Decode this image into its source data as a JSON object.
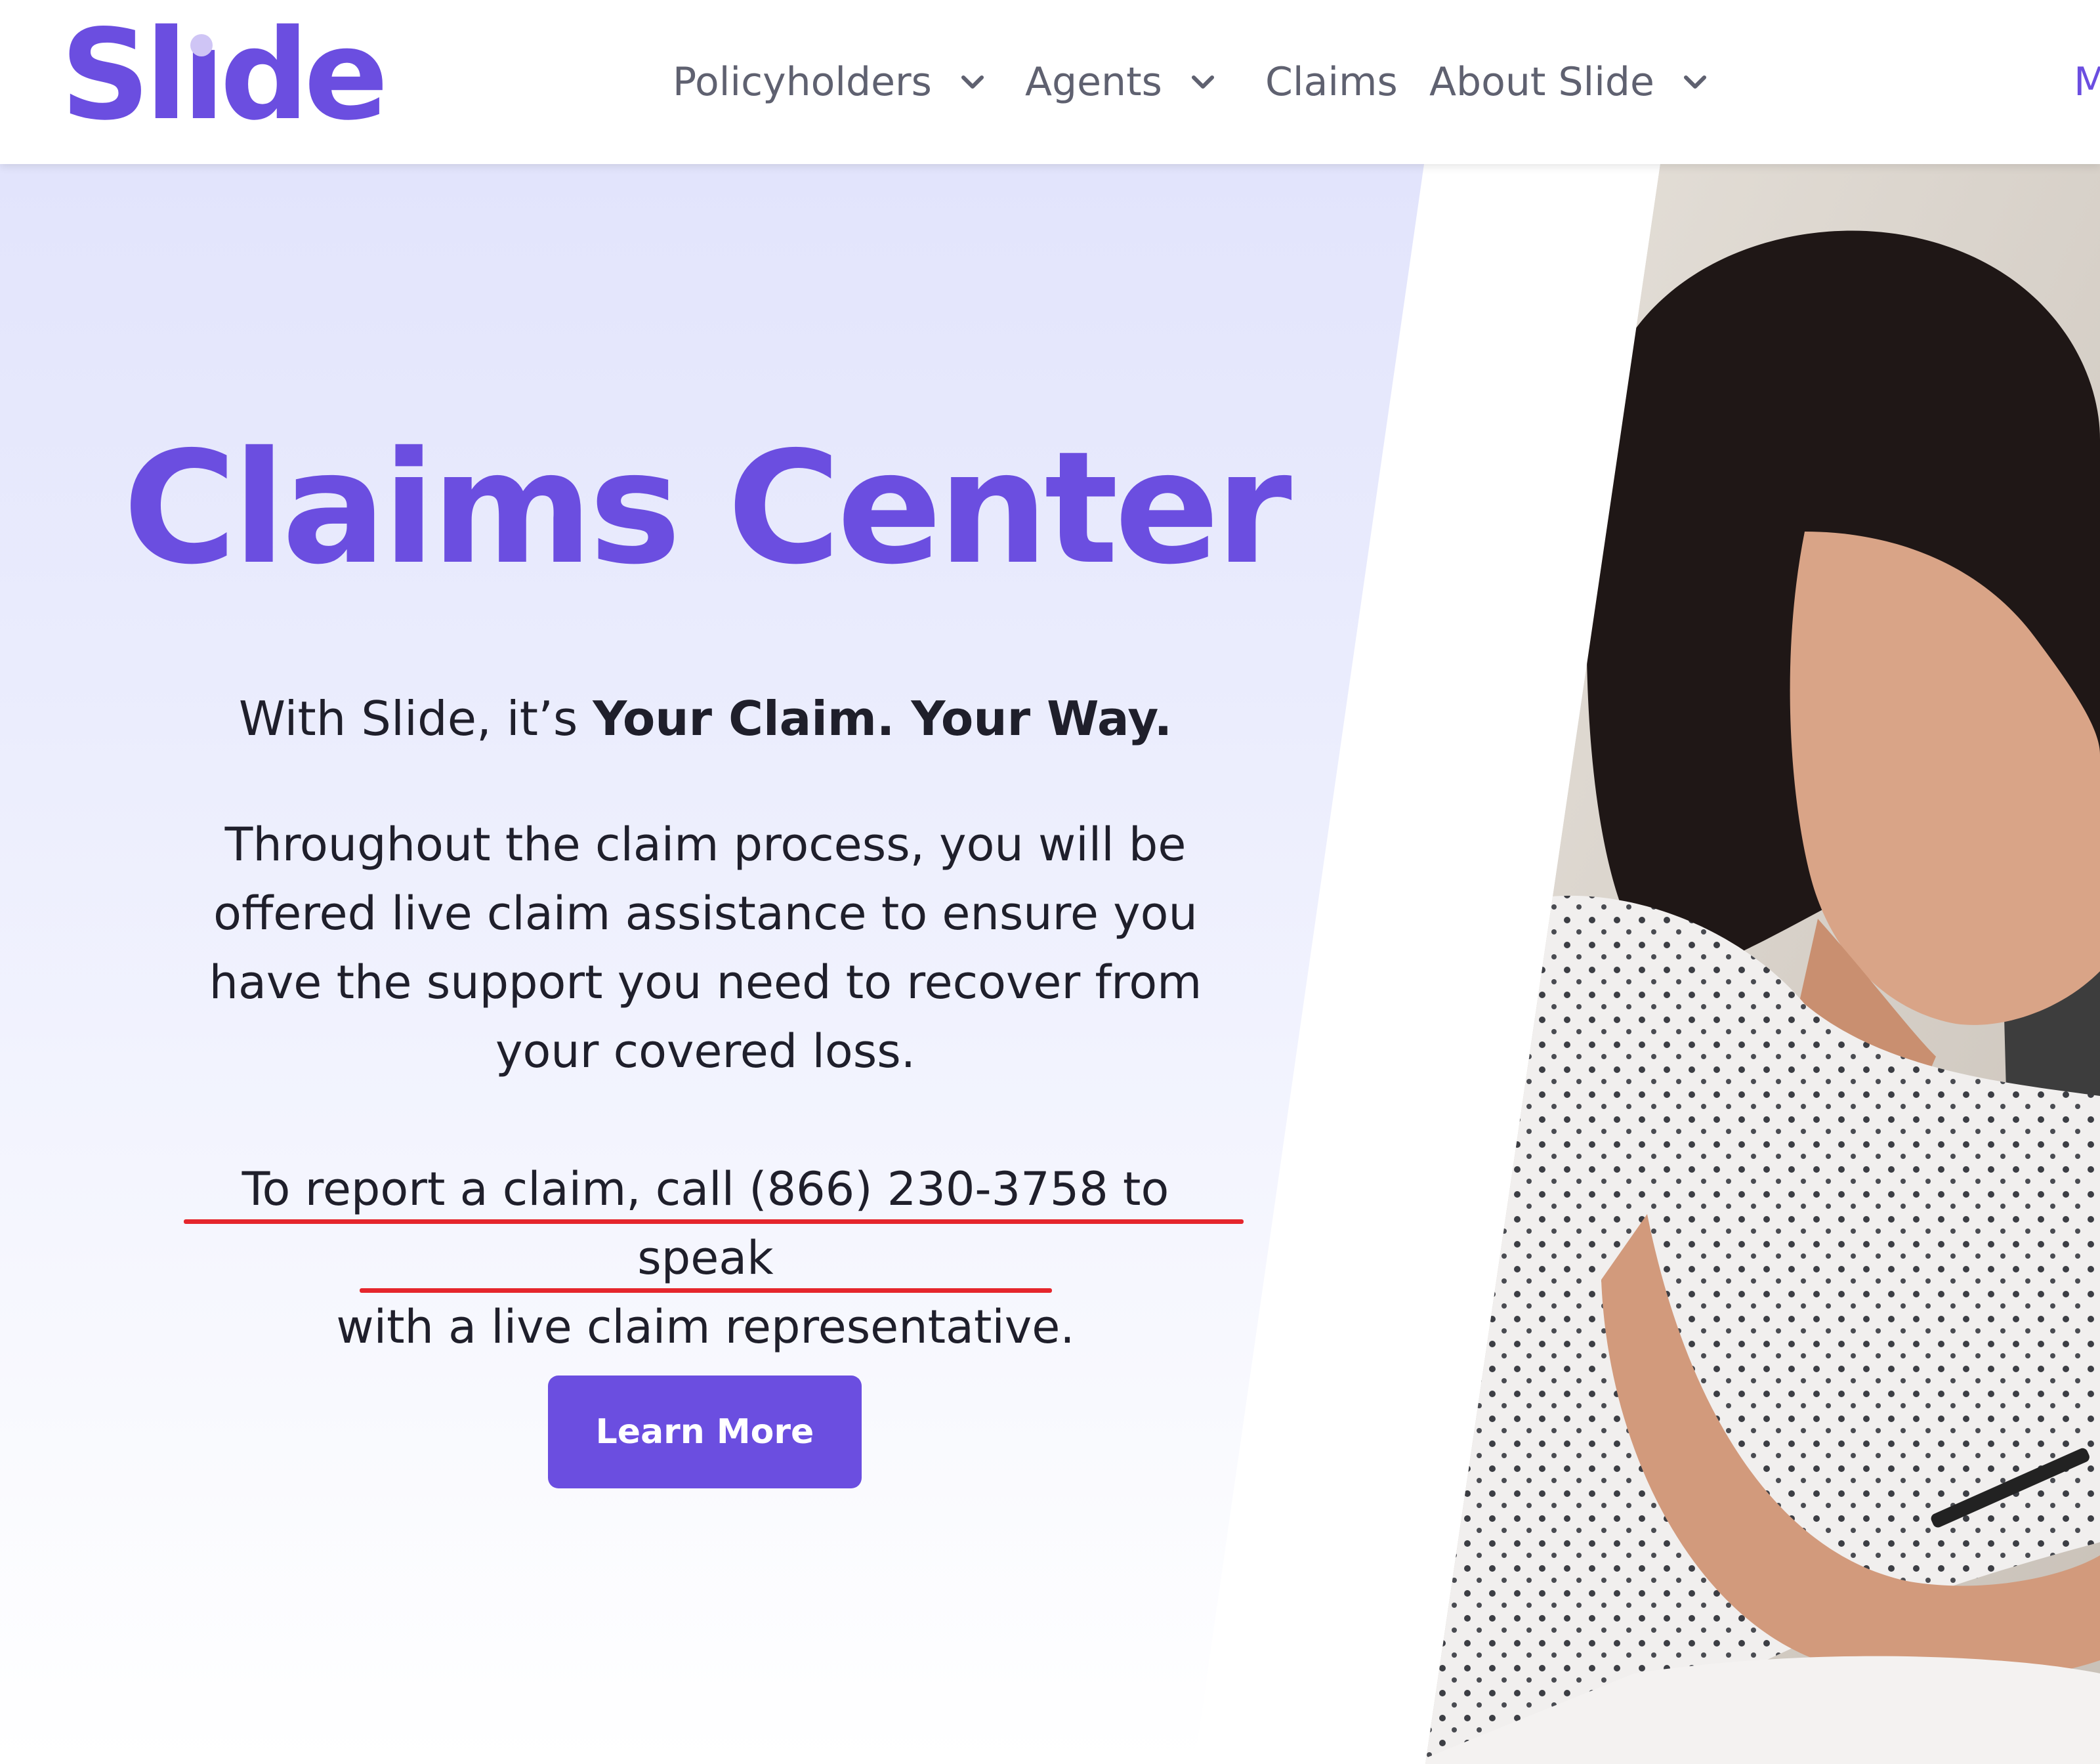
{
  "header": {
    "logo_text": "Slide",
    "nav": [
      {
        "label": "Policyholders",
        "has_dropdown": true
      },
      {
        "label": "Agents",
        "has_dropdown": true
      },
      {
        "label": "Claims",
        "has_dropdown": false
      },
      {
        "label": "About Slide",
        "has_dropdown": true
      }
    ],
    "cut_off_item": "M"
  },
  "hero": {
    "title": "Claims Center",
    "tagline_prefix": "With Slide, it’s ",
    "tagline_emphasis": "Your Claim. Your Way.",
    "paragraph": "Throughout the claim process, you will be offered live claim assistance to ensure you have the support you need to recover from your covered loss.",
    "report_line_1": "To report a claim, call (866) 230-3758 to speak",
    "report_line_2": "with a live claim representative.",
    "cta_label": "Learn More"
  },
  "colors": {
    "brand": "#6B4EE0",
    "annotation_underline": "#e5262d",
    "text": "#1f1f2b",
    "nav_text": "#5f6170"
  },
  "icons": [
    "chevron-down-icon"
  ]
}
